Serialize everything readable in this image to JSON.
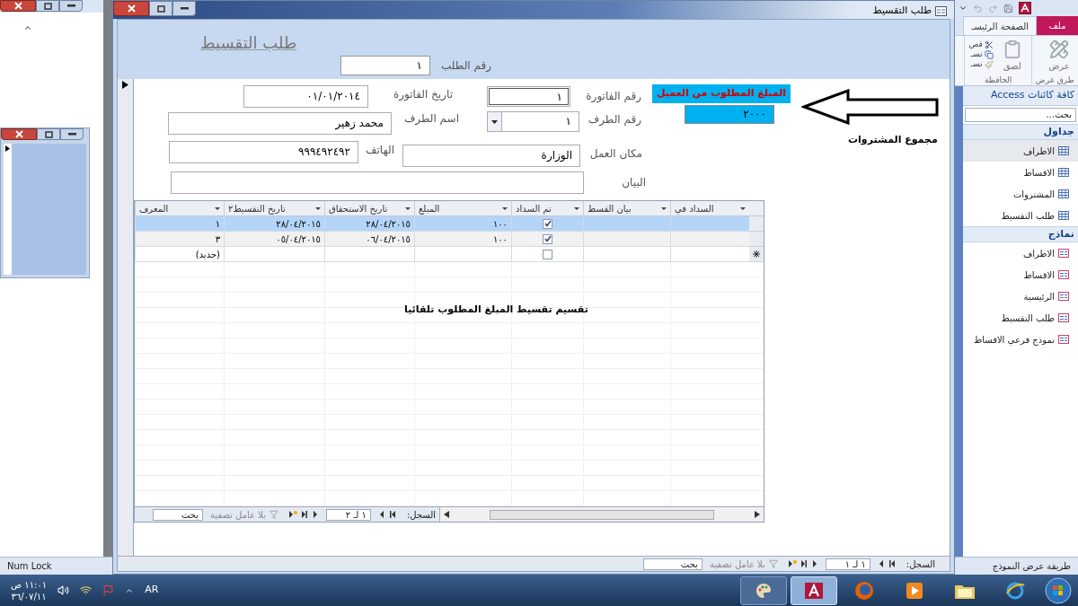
{
  "ribbon": {
    "tabs": [
      {
        "label": "ملف",
        "kind": "file",
        "selected": false
      },
      {
        "label": "الصفحة الرئيسـ",
        "kind": "tab",
        "selected": true
      }
    ],
    "groups": [
      {
        "label": "طرق عرض",
        "button": "عرض"
      },
      {
        "label": "الحافظة",
        "button": "لصق",
        "small": [
          "قص",
          "نسـ",
          "نسـ"
        ]
      }
    ]
  },
  "nav_pane": {
    "title": "كافة كائنات Access",
    "search_placeholder": "بحث...",
    "sections": [
      {
        "title": "جداول",
        "kind": "table",
        "items": [
          {
            "label": "الاطراف",
            "selected": true
          },
          {
            "label": "الاقساط",
            "selected": false
          },
          {
            "label": "المشتروات",
            "selected": false
          },
          {
            "label": "طلب التقسيط",
            "selected": false
          }
        ]
      },
      {
        "title": "نماذج",
        "kind": "form",
        "items": [
          {
            "label": "الاطراف",
            "selected": false
          },
          {
            "label": "الاقساط",
            "selected": false
          },
          {
            "label": "الرئيسية",
            "selected": false
          },
          {
            "label": "طلب التقسيط",
            "selected": false
          },
          {
            "label": "نموذج فرعي الاقساط",
            "selected": false
          }
        ]
      }
    ]
  },
  "form_window": {
    "title": "طلب التقسيط",
    "header": {
      "title": "طلب التقسيط",
      "request_number": {
        "label": "رقم الطلب",
        "value": "١"
      }
    },
    "fields": [
      {
        "label": "رقم الفاتورة",
        "value": "١",
        "kind": "text"
      },
      {
        "label": "تاريخ الفاتورة",
        "value": "٠١/٠١/٢٠١٤",
        "kind": "text"
      },
      {
        "label": "رقم الطرف",
        "value": "١",
        "kind": "combo"
      },
      {
        "label": "اسم الطرف",
        "value": "محمد زهير",
        "kind": "text"
      },
      {
        "label": "مكان العمل",
        "value": "الوزارة",
        "kind": "text"
      },
      {
        "label": "الهاتف",
        "value": "٩٩٩٤٩٢٤٩٢",
        "kind": "text"
      },
      {
        "label": "البيان",
        "kind": "text"
      }
    ],
    "required_amount": {
      "label": "المبلغ المطلوب من العميل",
      "value": "٢٠٠٠"
    },
    "purchases_total_label": "مجموع المشتروات",
    "subform": {
      "columns": [
        "السداد في",
        "بيان القسط",
        "تم السداد",
        "المبلغ",
        "تاريخ الاستحقاق",
        "تاريخ التقسيط٢",
        "المعرف"
      ],
      "rows": [
        {
          "paid": true,
          "amount": "١٠٠",
          "due_date": "٢٨/٠٤/٢٠١٥",
          "installment_date": "٢٨/٠٤/٢٠١٥",
          "id": "١",
          "selected": true
        },
        {
          "paid": true,
          "amount": "١٠٠",
          "due_date": "٠٦/٠٤/٢٠١٥",
          "installment_date": "٠٥/٠٤/٢٠١٥",
          "id": "٣",
          "selected": false
        }
      ],
      "new_row": {
        "paid": false,
        "id": "(جديد)"
      },
      "note": "تقسيم تقسيط المبلغ المطلوب تلقائيا",
      "navigation": {
        "label": "السجل:",
        "position": "١ لـ ٢",
        "filter": "بلا عامل تصفية",
        "search": "بحث"
      }
    },
    "navigation": {
      "label": "السجل:",
      "position": "١ لـ ١",
      "filter": "بلا عامل تصفية",
      "search": "بحث"
    }
  },
  "status_bar": {
    "left": "Num Lock",
    "right": "طريقة عرض النموذج"
  },
  "taskbar": {
    "language": "AR",
    "time": "١١:٠١ ص",
    "date": "٣٦/٠٧/١١"
  }
}
